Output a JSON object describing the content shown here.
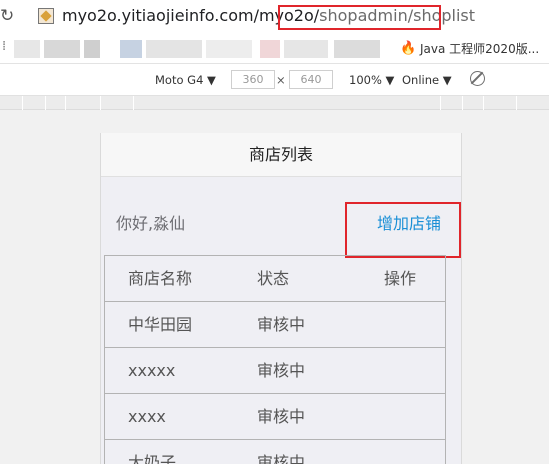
{
  "browser": {
    "url_host": "myo2o.yitiaojieinfo.com/myo2o/",
    "url_path": "shopadmin/shoplist",
    "bookmark_label": "Java 工程师2020版..."
  },
  "device_toolbar": {
    "device": "Moto G4 ▼",
    "width": "360",
    "separator": "×",
    "height": "640",
    "zoom": "100% ▼",
    "network": "Online ▼"
  },
  "page": {
    "title": "商店列表",
    "greeting": "你好,淼仙",
    "add_shop_link": "增加店铺",
    "table": {
      "headers": [
        "商店名称",
        "状态",
        "操作"
      ],
      "rows": [
        [
          "中华田园",
          "审核中",
          ""
        ],
        [
          "xxxxx",
          "审核中",
          ""
        ],
        [
          "xxxx",
          "审核中",
          ""
        ],
        [
          "大奶子",
          "审核中",
          ""
        ]
      ]
    }
  },
  "colors": {
    "highlight": "#e0252b",
    "link": "#1a8fd6"
  }
}
